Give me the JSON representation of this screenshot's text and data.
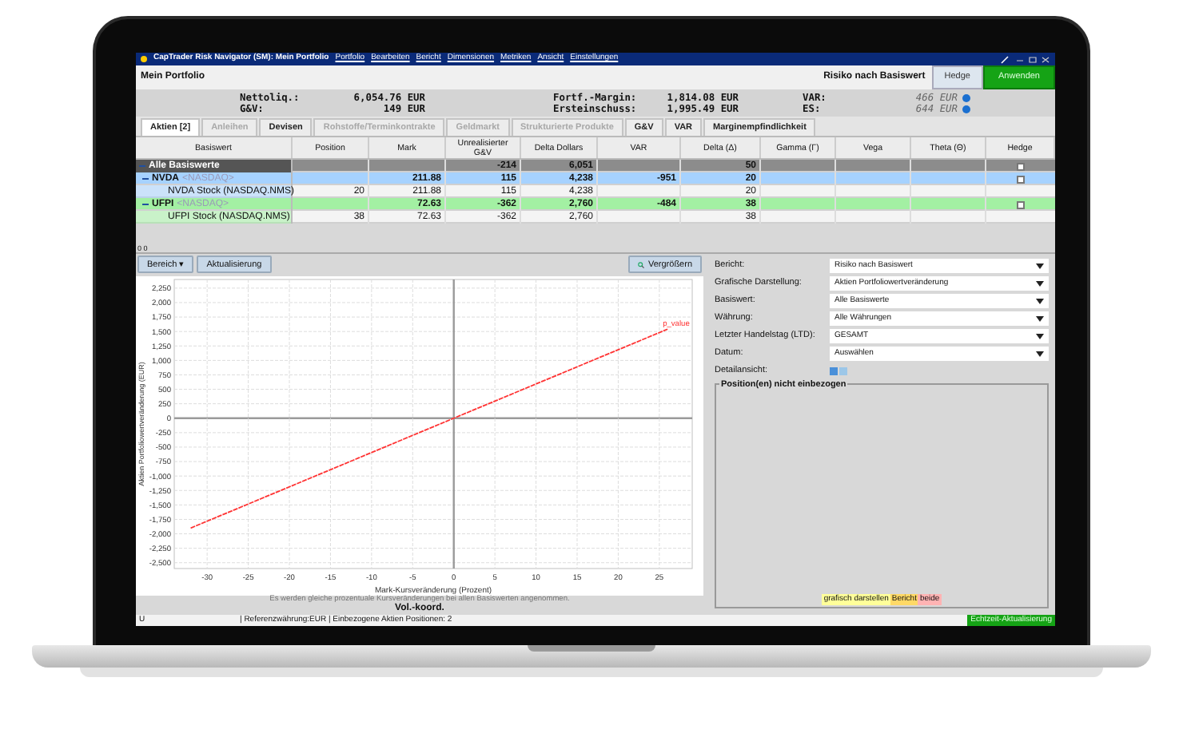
{
  "window": {
    "title": "CapTrader Risk Navigator (SM): Mein Portfolio",
    "menu": [
      "Portfolio",
      "Bearbeiten",
      "Bericht",
      "Dimensionen",
      "Metriken",
      "Ansicht",
      "Einstellungen"
    ]
  },
  "header": {
    "title": "Mein Portfolio",
    "report": "Risiko nach Basiswert",
    "buttons": [
      {
        "label": "Hedge",
        "kind": "plain"
      },
      {
        "label": "Anwenden",
        "kind": "primary"
      }
    ]
  },
  "summary": {
    "left": [
      {
        "label": "Nettoliq.:",
        "value": "6,054.76 EUR"
      },
      {
        "label": "G&V:",
        "value": "149 EUR"
      }
    ],
    "middle": [
      {
        "label": "Fortf.-Margin:",
        "value": "1,814.08 EUR"
      },
      {
        "label": "Ersteinschuss:",
        "value": "1,995.49 EUR"
      }
    ],
    "right": [
      {
        "label": "VAR:",
        "value": "466 EUR"
      },
      {
        "label": "ES:",
        "value": "644 EUR"
      }
    ]
  },
  "tabs": [
    {
      "label": "Aktien [2]",
      "selected": true,
      "disabled": false
    },
    {
      "label": "Anleihen",
      "selected": false,
      "disabled": true
    },
    {
      "label": "Devisen",
      "selected": false,
      "disabled": false
    },
    {
      "label": "Rohstoffe/Terminkontrakte",
      "selected": false,
      "disabled": true
    },
    {
      "label": "Geldmarkt",
      "selected": false,
      "disabled": true
    },
    {
      "label": "Strukturierte Produkte",
      "selected": false,
      "disabled": true
    },
    {
      "label": "G&V",
      "selected": false,
      "disabled": false
    },
    {
      "label": "VAR",
      "selected": false,
      "disabled": false
    },
    {
      "label": "Marginempfindlichkeit",
      "selected": false,
      "disabled": false
    }
  ],
  "table": {
    "columns": [
      "Basiswert",
      "Position",
      "Mark",
      "Unrealisierter G&V",
      "Delta Dollars",
      "VAR",
      "Delta (Δ)",
      "Gamma (Γ)",
      "Vega",
      "Theta (Θ)",
      "Hedge"
    ],
    "rows": [
      {
        "kind": "group",
        "name": "Alle Basiswerte",
        "expanded": true,
        "cells": [
          "",
          "",
          "-214",
          "6,051",
          "",
          "50",
          "",
          "",
          ""
        ],
        "hedge": false,
        "children": [
          {
            "kind": "underlying",
            "name": "NVDA",
            "exchange": "<NASDAQ>",
            "color": "#a6d2ff",
            "expanded": true,
            "cells": [
              "",
              "211.88",
              "115",
              "4,238",
              "-951",
              "20",
              "",
              "",
              ""
            ],
            "hedge": false,
            "children": [
              {
                "kind": "position",
                "name": "NVDA Stock (NASDAQ.NMS)",
                "cells": [
                  "20",
                  "211.88",
                  "115",
                  "4,238",
                  "",
                  "20",
                  "",
                  "",
                  ""
                ]
              }
            ]
          },
          {
            "kind": "underlying",
            "name": "UFPI",
            "exchange": "<NASDAQ>",
            "color": "#a3f0a3",
            "expanded": true,
            "cells": [
              "",
              "72.63",
              "-362",
              "2,760",
              "-484",
              "38",
              "",
              "",
              ""
            ],
            "hedge": false,
            "children": [
              {
                "kind": "position",
                "name": "UFPI Stock (NASDAQ.NMS)",
                "cells": [
                  "38",
                  "72.63",
                  "-362",
                  "2,760",
                  "",
                  "38",
                  "",
                  "",
                  ""
                ]
              }
            ]
          }
        ]
      }
    ]
  },
  "splitter": "0 0",
  "chart_panel": {
    "buttons": [
      "Bereich ▾",
      "Aktualisierung"
    ],
    "zoom_button": "Vergrößern",
    "chart_data": {
      "type": "line",
      "grid": true,
      "xlabel": "Mark-Kursveränderung (Prozent)",
      "ylabel": "Aktien Portfoliowertveränderung (EUR)",
      "xlim": [
        -34,
        29
      ],
      "ylim": [
        -2600,
        2400
      ],
      "xticks": [
        -30,
        -25,
        -20,
        -15,
        -10,
        -5,
        0,
        5,
        10,
        15,
        20,
        25
      ],
      "yticks": [
        {
          "value": 2250,
          "label": "2,250"
        },
        {
          "value": 2000,
          "label": "2,000"
        },
        {
          "value": 1750,
          "label": "1,750"
        },
        {
          "value": 1500,
          "label": "1,500"
        },
        {
          "value": 1250,
          "label": "1,250"
        },
        {
          "value": 1000,
          "label": "1,000"
        },
        {
          "value": 750,
          "label": "750"
        },
        {
          "value": 500,
          "label": "500"
        },
        {
          "value": 250,
          "label": "250"
        },
        {
          "value": 0,
          "label": "0"
        },
        {
          "value": -250,
          "label": "-250"
        },
        {
          "value": -500,
          "label": "-500"
        },
        {
          "value": -750,
          "label": "-750"
        },
        {
          "value": -1000,
          "label": "-1,000"
        },
        {
          "value": -1250,
          "label": "-1,250"
        },
        {
          "value": -1500,
          "label": "-1,500"
        },
        {
          "value": -1750,
          "label": "-1,750"
        },
        {
          "value": -2000,
          "label": "-2,000"
        },
        {
          "value": -2250,
          "label": "-2,250"
        },
        {
          "value": -2500,
          "label": "-2,500"
        }
      ],
      "x": [
        -32,
        0,
        26
      ],
      "series": [
        {
          "name": "p_value",
          "color": "#ff3333",
          "line_style": "dashed",
          "values": [
            -1900,
            0,
            1540
          ]
        }
      ]
    },
    "note": "Es werden gleiche prozentuale Kursveränderungen bei allen Basiswerten angenommen.",
    "footer": "Vol.-koord."
  },
  "settings": {
    "fields": [
      {
        "label": "Bericht:",
        "value": "Risiko nach Basiswert"
      },
      {
        "label": "Grafische Darstellung:",
        "value": "Aktien Portfoliowertveränderung"
      },
      {
        "label": "Basiswert:",
        "value": "Alle Basiswerte"
      },
      {
        "label": "Währung:",
        "value": "Alle Währungen"
      },
      {
        "label": "Letzter Handelstag (LTD):",
        "value": "GESAMT"
      },
      {
        "label": "Datum:",
        "value": "Auswählen"
      }
    ],
    "detail_label": "Detailansicht:",
    "group_title": "Position(en) nicht einbezogen",
    "legend": [
      {
        "label": "grafisch darstellen",
        "color": "#ffff99"
      },
      {
        "label": "Bericht",
        "color": "#ffd966"
      },
      {
        "label": "beide",
        "color": "#ffb3b3"
      }
    ]
  },
  "status_bar": {
    "field": "U",
    "info": "| Referenzwährung:EUR | Einbezogene Aktien Positionen: 2",
    "realtime": "Echtzeit-Aktualisierung"
  }
}
